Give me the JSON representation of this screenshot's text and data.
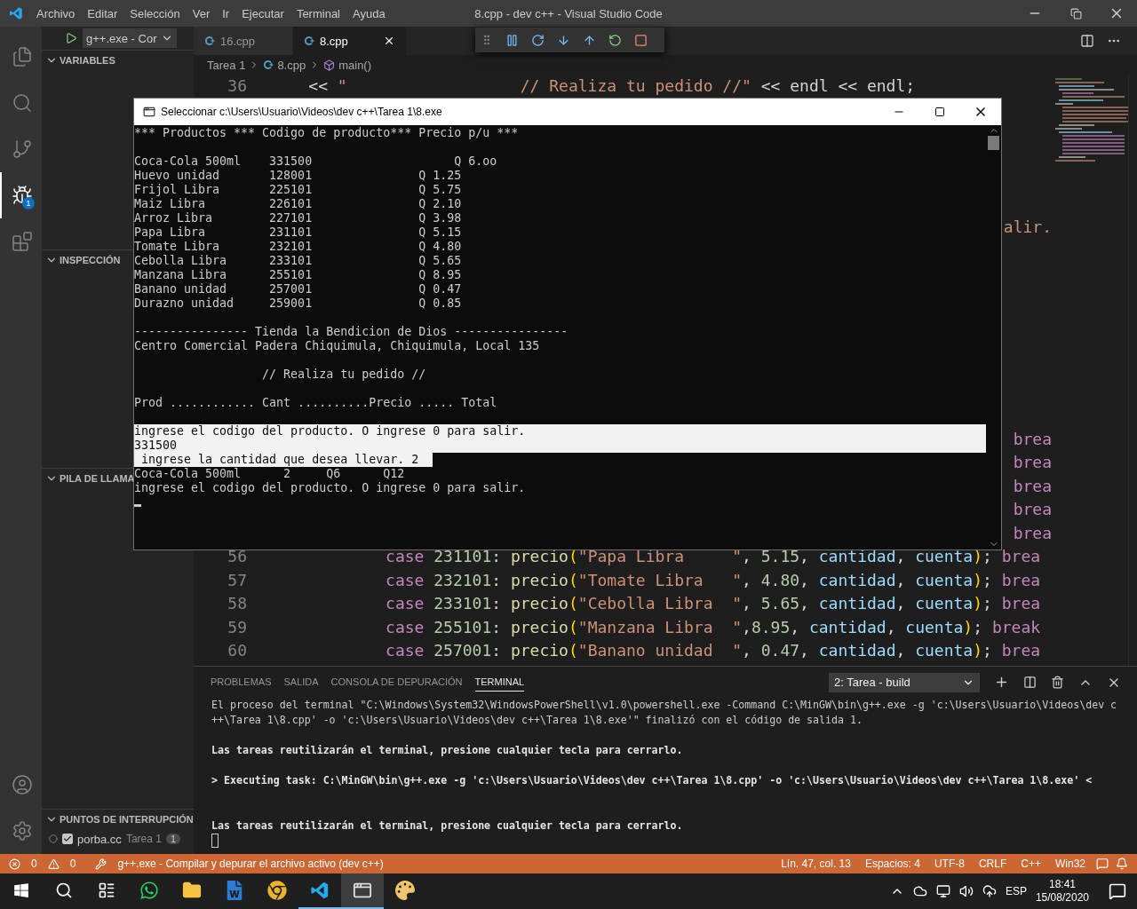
{
  "window": {
    "title": "8.cpp - dev c++ - Visual Studio Code",
    "menu": [
      "Archivo",
      "Editar",
      "Selección",
      "Ver",
      "Ir",
      "Ejecutar",
      "Terminal",
      "Ayuda"
    ]
  },
  "activity_bar": {
    "items": [
      {
        "kind": "files",
        "selected": false
      },
      {
        "kind": "search",
        "selected": false
      },
      {
        "kind": "source-control",
        "selected": false
      },
      {
        "kind": "debug",
        "selected": true,
        "badge": "1"
      },
      {
        "kind": "extensions",
        "selected": false
      }
    ],
    "bottom": [
      {
        "kind": "account"
      },
      {
        "kind": "settings"
      }
    ]
  },
  "sidebar": {
    "launch_config": "g++.exe - Cor",
    "sections": [
      {
        "title": "VARIABLES",
        "expanded": true
      },
      {
        "title": "INSPECCIÓN",
        "expanded": true
      },
      {
        "title": "PILA DE LLAMA",
        "expanded": true
      },
      {
        "title": "PUNTOS DE INTERRUPCIÓN",
        "expanded": true
      }
    ],
    "breakpoints": [
      {
        "file": "porba.cc",
        "folder": "Tarea 1",
        "count": "1",
        "checked": true
      }
    ]
  },
  "editor": {
    "tabs": [
      {
        "label": "16.cpp",
        "selected": false
      },
      {
        "label": "8.cpp",
        "selected": true
      }
    ],
    "breadcrumb": [
      "Tarea 1",
      "8.cpp",
      "main()"
    ],
    "lines": [
      {
        "kind": "code",
        "number": "36",
        "tokens": [
          {
            "kind": "p",
            "text": "    << "
          },
          {
            "kind": "str",
            "text": "\"                  // Realiza tu pedido //\""
          },
          {
            "kind": "p",
            "text": " << endl << endl;"
          }
        ]
      },
      {
        "kind": "covered"
      },
      {
        "kind": "covered"
      },
      {
        "kind": "covered"
      },
      {
        "kind": "covered"
      },
      {
        "kind": "covered"
      },
      {
        "kind": "tail",
        "tokens": [
          {
            "kind": "str",
            "text": "alir."
          }
        ]
      },
      {
        "kind": "covered"
      },
      {
        "kind": "covered"
      },
      {
        "kind": "covered"
      },
      {
        "kind": "covered"
      },
      {
        "kind": "covered"
      },
      {
        "kind": "covered"
      },
      {
        "kind": "covered"
      },
      {
        "kind": "covered"
      },
      {
        "kind": "tail",
        "tokens": [
          {
            "kind": "kw",
            "text": "brea"
          }
        ]
      },
      {
        "kind": "tail",
        "tokens": [
          {
            "kind": "kw",
            "text": "brea"
          }
        ]
      },
      {
        "kind": "tail",
        "tokens": [
          {
            "kind": "kw",
            "text": "brea"
          }
        ]
      },
      {
        "kind": "tail",
        "tokens": [
          {
            "kind": "kw",
            "text": "brea"
          }
        ]
      },
      {
        "kind": "tail",
        "tokens": [
          {
            "kind": "kw",
            "text": "brea"
          }
        ]
      },
      {
        "kind": "code",
        "number": "56",
        "tokens": [
          {
            "kind": "kw",
            "text": "            case"
          },
          {
            "kind": "num",
            "text": " 231101"
          },
          {
            "kind": "p",
            "text": ": "
          },
          {
            "kind": "fn",
            "text": "precio"
          },
          {
            "kind": "paren",
            "text": "("
          },
          {
            "kind": "str",
            "text": "\"Papa Libra     \""
          },
          {
            "kind": "p",
            "text": ", "
          },
          {
            "kind": "num",
            "text": "5.15"
          },
          {
            "kind": "p",
            "text": ", "
          },
          {
            "kind": "var",
            "text": "cantidad"
          },
          {
            "kind": "p",
            "text": ", "
          },
          {
            "kind": "var",
            "text": "cuenta"
          },
          {
            "kind": "paren",
            "text": ")"
          },
          {
            "kind": "p",
            "text": "; "
          },
          {
            "kind": "kw",
            "text": "brea"
          }
        ]
      },
      {
        "kind": "code",
        "number": "57",
        "tokens": [
          {
            "kind": "kw",
            "text": "            case"
          },
          {
            "kind": "num",
            "text": " 232101"
          },
          {
            "kind": "p",
            "text": ": "
          },
          {
            "kind": "fn",
            "text": "precio"
          },
          {
            "kind": "paren",
            "text": "("
          },
          {
            "kind": "str",
            "text": "\"Tomate Libra   \""
          },
          {
            "kind": "p",
            "text": ", "
          },
          {
            "kind": "num",
            "text": "4.80"
          },
          {
            "kind": "p",
            "text": ", "
          },
          {
            "kind": "var",
            "text": "cantidad"
          },
          {
            "kind": "p",
            "text": ", "
          },
          {
            "kind": "var",
            "text": "cuenta"
          },
          {
            "kind": "paren",
            "text": ")"
          },
          {
            "kind": "p",
            "text": "; "
          },
          {
            "kind": "kw",
            "text": "brea"
          }
        ]
      },
      {
        "kind": "code",
        "number": "58",
        "tokens": [
          {
            "kind": "kw",
            "text": "            case"
          },
          {
            "kind": "num",
            "text": " 233101"
          },
          {
            "kind": "p",
            "text": ": "
          },
          {
            "kind": "fn",
            "text": "precio"
          },
          {
            "kind": "paren",
            "text": "("
          },
          {
            "kind": "str",
            "text": "\"Cebolla Libra  \""
          },
          {
            "kind": "p",
            "text": ", "
          },
          {
            "kind": "num",
            "text": "5.65"
          },
          {
            "kind": "p",
            "text": ", "
          },
          {
            "kind": "var",
            "text": "cantidad"
          },
          {
            "kind": "p",
            "text": ", "
          },
          {
            "kind": "var",
            "text": "cuenta"
          },
          {
            "kind": "paren",
            "text": ")"
          },
          {
            "kind": "p",
            "text": "; "
          },
          {
            "kind": "kw",
            "text": "brea"
          }
        ]
      },
      {
        "kind": "code",
        "number": "59",
        "tokens": [
          {
            "kind": "kw",
            "text": "            case"
          },
          {
            "kind": "num",
            "text": " 255101"
          },
          {
            "kind": "p",
            "text": ": "
          },
          {
            "kind": "fn",
            "text": "precio"
          },
          {
            "kind": "paren",
            "text": "("
          },
          {
            "kind": "str",
            "text": "\"Manzana Libra  \""
          },
          {
            "kind": "p",
            "text": ","
          },
          {
            "kind": "num",
            "text": "8.95"
          },
          {
            "kind": "p",
            "text": ", "
          },
          {
            "kind": "var",
            "text": "cantidad"
          },
          {
            "kind": "p",
            "text": ", "
          },
          {
            "kind": "var",
            "text": "cuenta"
          },
          {
            "kind": "paren",
            "text": ")"
          },
          {
            "kind": "p",
            "text": "; "
          },
          {
            "kind": "kw",
            "text": "break"
          }
        ]
      },
      {
        "kind": "code",
        "number": "60",
        "tokens": [
          {
            "kind": "kw",
            "text": "            case"
          },
          {
            "kind": "num",
            "text": " 257001"
          },
          {
            "kind": "p",
            "text": ": "
          },
          {
            "kind": "fn",
            "text": "precio"
          },
          {
            "kind": "paren",
            "text": "("
          },
          {
            "kind": "str",
            "text": "\"Banano unidad  \""
          },
          {
            "kind": "p",
            "text": ", "
          },
          {
            "kind": "num",
            "text": "0.47"
          },
          {
            "kind": "p",
            "text": ", "
          },
          {
            "kind": "var",
            "text": "cantidad"
          },
          {
            "kind": "p",
            "text": ", "
          },
          {
            "kind": "var",
            "text": "cuenta"
          },
          {
            "kind": "paren",
            "text": ")"
          },
          {
            "kind": "p",
            "text": "; "
          },
          {
            "kind": "kw",
            "text": "brea"
          }
        ]
      }
    ]
  },
  "console_window": {
    "title": "Seleccionar c:\\Users\\Usuario\\Videos\\dev c++\\Tarea 1\\8.exe",
    "blocks": [
      [
        {
          "text": "*** Productos *** Codigo de producto*** Precio p/u ***",
          "selected": false
        }
      ],
      [
        {
          "text": "Coca-Cola 500ml    331500                    Q 6.oo",
          "selected": false
        },
        {
          "text": "Huevo unidad       128001               Q 1.25",
          "selected": false
        },
        {
          "text": "Frijol Libra       225101               Q 5.75",
          "selected": false
        },
        {
          "text": "Maiz Libra         226101               Q 2.10",
          "selected": false
        },
        {
          "text": "Arroz Libra        227101               Q 3.98",
          "selected": false
        },
        {
          "text": "Papa Libra         231101               Q 5.15",
          "selected": false
        },
        {
          "text": "Tomate Libra       232101               Q 4.80",
          "selected": false
        },
        {
          "text": "Cebolla Libra      233101               Q 5.65",
          "selected": false
        },
        {
          "text": "Manzana Libra      255101               Q 8.95",
          "selected": false
        },
        {
          "text": "Banano unidad      257001               Q 0.47",
          "selected": false
        },
        {
          "text": "Durazno unidad     259001               Q 0.85",
          "selected": false
        }
      ],
      [
        {
          "text": "---------------- Tienda la Bendicion de Dios ----------------",
          "selected": false
        },
        {
          "text": "Centro Comercial Padera Chiquimula, Chiquimula, Local 135",
          "selected": false
        }
      ],
      [
        {
          "text": "                  // Realiza tu pedido //",
          "selected": false
        }
      ],
      [
        {
          "text": "Prod ............ Cant ..........Precio ..... Total",
          "selected": false
        }
      ],
      [
        {
          "text": "ingrese el codigo del producto. O ingrese 0 para salir.",
          "selected": true
        },
        {
          "text": "331500",
          "selected": true
        },
        {
          "text": " ingrese la cantidad que desea llevar. 2",
          "selected": true
        },
        {
          "text": "Coca-Cola 500ml      2     Q6      Q12",
          "selected": false
        },
        {
          "text": "ingrese el codigo del producto. O ingrese 0 para salir.",
          "selected": false
        }
      ]
    ]
  },
  "panel": {
    "tabs": [
      {
        "label": "PROBLEMAS",
        "selected": false
      },
      {
        "label": "SALIDA",
        "selected": false
      },
      {
        "label": "CONSOLA DE DEPURACIÓN",
        "selected": false
      },
      {
        "label": "TERMINAL",
        "selected": true
      }
    ],
    "terminal_picker": "2: Tarea - build",
    "terminal_blocks": [
      {
        "extra_blank_line": false,
        "lines": [
          {
            "text": "El proceso del terminal \"C:\\Windows\\System32\\WindowsPowerShell\\v1.0\\powershell.exe -Command C:\\MinGW\\bin\\g++.exe -g 'c:\\Users\\Usuario\\Videos\\dev c++\\Tarea 1\\8.cpp' -o 'c:\\Users\\Usuario\\Videos\\dev c++\\Tarea 1\\8.exe'\" finalizó con el código de salida 1.",
            "bold": false
          }
        ]
      },
      {
        "extra_blank_line": false,
        "lines": [
          {
            "text": "Las tareas reutilizarán el terminal, presione cualquier tecla para cerrarlo.",
            "bold": true
          }
        ]
      },
      {
        "extra_blank_line": true,
        "lines": [
          {
            "text": "> Executing task: C:\\MinGW\\bin\\g++.exe -g 'c:\\Users\\Usuario\\Videos\\dev c++\\Tarea 1\\8.cpp' -o 'c:\\Users\\Usuario\\Videos\\dev c++\\Tarea 1\\8.exe' <",
            "bold": true
          }
        ]
      },
      {
        "extra_blank_line": false,
        "lines": [
          {
            "text": "Las tareas reutilizarán el terminal, presione cualquier tecla para cerrarlo.",
            "bold": true
          }
        ]
      }
    ]
  },
  "status_bar": {
    "errors": "0",
    "warnings": "0",
    "task": "g++.exe - Compilar y depurar el archivo activo (dev c++)",
    "items": [
      "Lín. 47, col. 13",
      "Espacios: 4",
      "UTF-8",
      "CRLF",
      "C++",
      "Win32"
    ]
  },
  "taskbar": {
    "apps": [
      {
        "kind": "whatsapp",
        "running": false,
        "active": false
      },
      {
        "kind": "folder",
        "running": false,
        "active": false
      },
      {
        "kind": "word",
        "running": false,
        "active": false
      },
      {
        "kind": "chrome",
        "running": false,
        "active": false
      },
      {
        "kind": "vscode",
        "running": true,
        "active": false
      },
      {
        "kind": "console",
        "running": true,
        "active": true
      },
      {
        "kind": "paint",
        "running": false,
        "active": false
      }
    ],
    "language": "ESP",
    "time": "18:41",
    "date": "15/08/2020"
  }
}
